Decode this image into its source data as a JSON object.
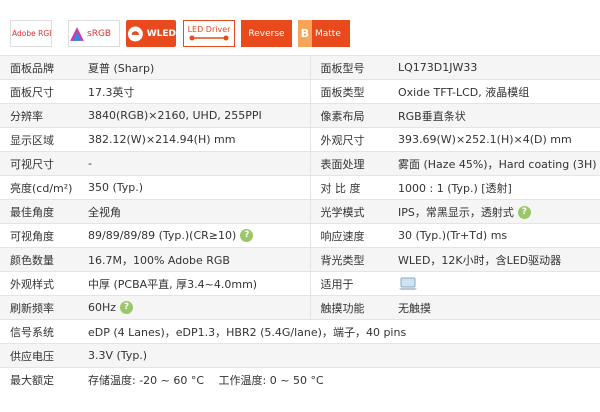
{
  "badges": {
    "adobe": "Adobe RGB",
    "srgb": "sRGB",
    "wled": "WLED",
    "led_driver": "LED Driver",
    "reverse": "Reverse",
    "matte": "Matte",
    "matte_prefix": "B"
  },
  "rows": [
    {
      "l1": "面板品牌",
      "v1": "夏普 (Sharp)",
      "l2": "面板型号",
      "v2": "LQ173D1JW33"
    },
    {
      "l1": "面板尺寸",
      "v1": "17.3英寸",
      "l2": "面板类型",
      "v2": "Oxide TFT-LCD, 液晶模组"
    },
    {
      "l1": "分辨率",
      "v1": "3840(RGB)×2160, UHD, 255PPI",
      "l2": "像素布局",
      "v2": "RGB垂直条状"
    },
    {
      "l1": "显示区域",
      "v1": "382.12(W)×214.94(H) mm",
      "l2": "外观尺寸",
      "v2": "393.69(W)×252.1(H)×4(D) mm"
    },
    {
      "l1": "可视尺寸",
      "v1": "-",
      "l2": "表面处理",
      "v2": "雾面 (Haze 45%)，Hard coating (3H)"
    },
    {
      "l1": "亮度(cd/m²)",
      "v1": "350 (Typ.)",
      "l2": "对 比 度",
      "v2": "1000 : 1 (Typ.) [透射]"
    },
    {
      "l1": "最佳角度",
      "v1": "全视角",
      "l2": "光学模式",
      "v2": "IPS，常黑显示，透射式"
    },
    {
      "l1": "可视角度",
      "v1": "89/89/89/89 (Typ.)(CR≥10)",
      "l2": "响应速度",
      "v2": "30 (Typ.)(Tr+Td) ms"
    },
    {
      "l1": "颜色数量",
      "v1": "16.7M，100% Adobe RGB",
      "l2": "背光类型",
      "v2": "WLED，12K小时，含LED驱动器"
    },
    {
      "l1": "外观样式",
      "v1": "中厚 (PCBA平直, 厚3.4~4.0mm)",
      "l2": "适用于",
      "v2": ""
    },
    {
      "l1": "刷新频率",
      "v1": "60Hz",
      "l2": "触摸功能",
      "v2": "无触摸"
    },
    {
      "l1": "信号系统",
      "v1": "eDP (4 Lanes)，eDP1.3，HBR2 (5.4G/lane)，端子，40 pins"
    },
    {
      "l1": "供应电压",
      "v1": "3.3V (Typ.)"
    },
    {
      "l1": "最大额定",
      "v1": "存储温度: -20 ~ 60 °C　 工作温度: 0 ~ 50 °C"
    }
  ],
  "help_mark": "?",
  "colors": {
    "accent": "#e8491d",
    "help": "#9bc76b",
    "stripe": "#f5f5f5"
  }
}
